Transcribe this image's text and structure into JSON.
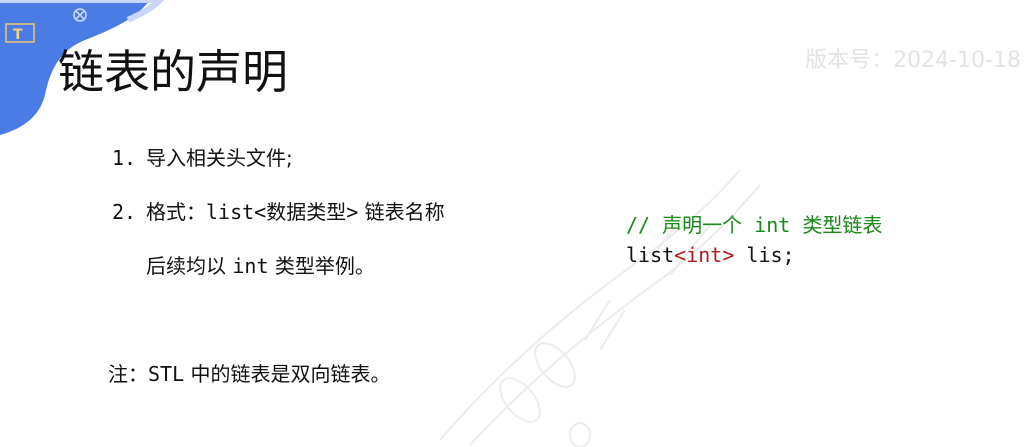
{
  "slide": {
    "title": "链表的声明",
    "version_watermark": "版本号：2024-10-18",
    "points": [
      {
        "number": "1.",
        "text": "导入相关头文件;"
      },
      {
        "number": "2.",
        "label": "格式：",
        "code": "list<数据类型>",
        "text": " 链表名称"
      }
    ],
    "continuation": {
      "prefix": "后续均以 ",
      "code": "int",
      "suffix": " 类型举例。"
    },
    "note": {
      "label": "注：",
      "code": "STL",
      "text": " 中的链表是双向链表。"
    }
  },
  "code_example": {
    "comment": "// 声明一个 int 类型链表",
    "line_prefix": "list",
    "line_type": "<int>",
    "line_suffix": " lis;"
  },
  "colors": {
    "corner_blue": "#4b7be5",
    "comment_green": "#178a17",
    "type_red": "#b01b1b"
  }
}
